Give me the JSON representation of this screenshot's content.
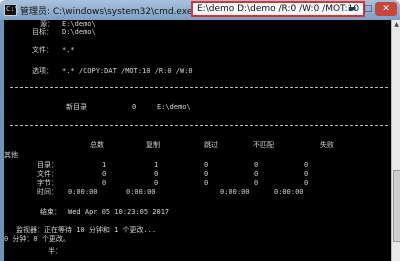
{
  "window": {
    "title_prefix": "管理员: C:\\windows\\system32\\cmd.exe - robocopy",
    "command_args": "E:\\demo D:\\demo /R:0 /W:0 /MOT:10",
    "controls": {
      "minimize": "▬",
      "maximize": "□",
      "close": "✕"
    }
  },
  "console": {
    "source_label": "源：",
    "source_value": "E:\\demo\\",
    "dest_label": "目标：",
    "dest_value": "D:\\demo\\",
    "files_label": "文件：",
    "files_value": "*.*",
    "options_label": "选项：",
    "options_value": "*.* /COPY:DAT /MOT:10 /R:0 /W:0",
    "new_dir_label": "新目录",
    "new_dir_count": "0",
    "new_dir_path": "E:\\demo\\",
    "stats": {
      "headers": [
        "总数",
        "复制",
        "跳过",
        "不匹配",
        "失败"
      ],
      "other_label": "其他",
      "rows": [
        {
          "label": "目录：",
          "values": [
            "1",
            "1",
            "0",
            "0",
            "0"
          ]
        },
        {
          "label": "文件：",
          "values": [
            "0",
            "0",
            "0",
            "0",
            "0"
          ]
        },
        {
          "label": "字节：",
          "values": [
            "0",
            "0",
            "0",
            "0",
            "0"
          ]
        },
        {
          "label": "时间：",
          "values": [
            "0:00:00",
            "0:00:00",
            "",
            "0:00:00",
            "0:00:00"
          ]
        }
      ]
    },
    "end_label": "结束：",
    "end_value": "Wed Apr 05 10:23:05 2017",
    "monitor_line": "监视器：正在等待 10 分钟和 1 个更改...",
    "changes_line": "0 分钟：0 个更改。",
    "last_line": "半："
  }
}
